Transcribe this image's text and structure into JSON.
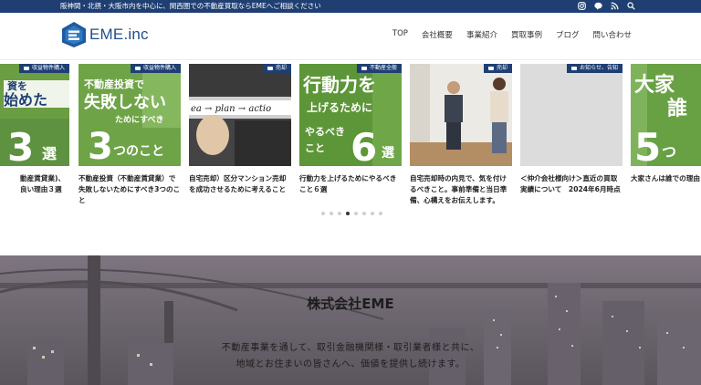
{
  "topbar": {
    "message": "阪神間・北摂・大阪市内を中心に、関西圏での不動産買取ならEMEへご相談ください",
    "icons": [
      "instagram-icon",
      "line-icon",
      "rss-icon",
      "search-icon"
    ]
  },
  "header": {
    "logo_text": "EME.inc",
    "nav": [
      "TOP",
      "会社概要",
      "事業紹介",
      "買取事例",
      "ブログ",
      "問い合わせ"
    ]
  },
  "slider": {
    "cards": [
      {
        "badge": "収益物件購入",
        "thumb_lines": [
          "資を",
          "始めた",
          "3",
          "選"
        ],
        "title": "動産賃貸業)、良い理由３選",
        "badge_color": "#1f3f73"
      },
      {
        "badge": "収益物件購入",
        "thumb_lines": [
          "不動産投資で",
          "失敗しない",
          "ためにすべき",
          "3つのこと"
        ],
        "title": "不動産投資（不動産賃貸業）で失敗しないためにすべき3つのこと",
        "badge_color": "#1f3f73"
      },
      {
        "badge": "売却",
        "thumb_lines": [
          "ea",
          "plan",
          "actio"
        ],
        "title": "自宅売却）区分マンション売却を成功させるために考えること",
        "badge_color": "#1f3f73"
      },
      {
        "badge": "不動産全般",
        "thumb_lines": [
          "行動力を",
          "上げるために",
          "やるべき",
          "こと",
          "6",
          "選"
        ],
        "title": "行動力を上げるためにやるべきこと６選",
        "badge_color": "#1f3f73"
      },
      {
        "badge": "売却",
        "thumb_lines": [],
        "title": "自宅売却時の内見で、気を付けるべきこと。事前準備と当日準備、心構えをお伝えします。",
        "badge_color": "#1f3f73"
      },
      {
        "badge": "お知らせ、告知",
        "thumb_lines": [],
        "title": "＜仲介会社様向け＞直近の買取実績について　2024年6月時点",
        "badge_color": "#1f3f73"
      },
      {
        "badge": "",
        "thumb_lines": [
          "大家",
          "誰",
          "5つ"
        ],
        "title": "大家さんは誰での理由",
        "badge_color": "#1f3f73"
      }
    ],
    "dots": 8,
    "active_dot": 3
  },
  "hero": {
    "title": "株式会社EME",
    "lines": [
      "不動産事業を通して、取引金融機関様・取引業者様と共に、",
      "地域とお住まいの皆さんへ、価値を提供し続けます。"
    ]
  }
}
